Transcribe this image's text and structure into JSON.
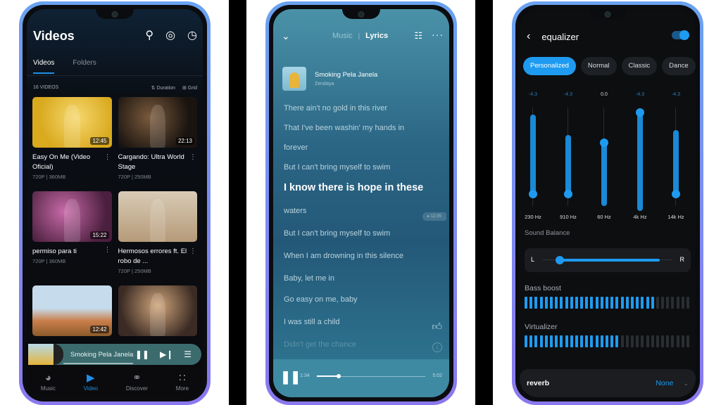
{
  "phone1": {
    "title": "Videos",
    "header_icons": [
      "search-icon",
      "radar-icon",
      "history-icon"
    ],
    "tabs": [
      {
        "label": "Videos",
        "active": true
      },
      {
        "label": "Folders",
        "active": false
      }
    ],
    "count_label": "16 VIDEOS",
    "sort_label": "Duration",
    "view_label": "Grid",
    "videos": [
      {
        "title": "Easy On Me (Video Oficial)",
        "meta": "720P | 360MB",
        "duration": "12:45"
      },
      {
        "title": "Cargando: Ultra World Stage",
        "meta": "720P | 250MB",
        "duration": "22:13"
      },
      {
        "title": "permiso para ti",
        "meta": "720P | 360MB",
        "duration": "15:22"
      },
      {
        "title": "Hermosos errores ft. El robo de ...",
        "meta": "720P | 250MB",
        "duration": ""
      },
      {
        "title": "",
        "meta": "",
        "duration": "12:42"
      },
      {
        "title": "",
        "meta": "",
        "duration": ""
      }
    ],
    "mini_player": {
      "title": "Smoking Pela Janela",
      "progress": 0.45
    },
    "nav": [
      {
        "label": "Music",
        "icon": "music-disc-icon",
        "active": false
      },
      {
        "label": "Video",
        "icon": "video-play-icon",
        "active": true
      },
      {
        "label": "Discover",
        "icon": "planet-icon",
        "active": false
      },
      {
        "label": "More",
        "icon": "grid-more-icon",
        "active": false
      }
    ]
  },
  "phone2": {
    "tabs": {
      "music": "Music",
      "separator": "|",
      "lyrics": "Lyrics"
    },
    "song": {
      "title": "Smoking Pela Janela",
      "artist": "Zendaya"
    },
    "lyrics": [
      {
        "text": "There ain't no gold in this river",
        "state": "normal"
      },
      {
        "text": "That I've been washin' my hands in",
        "state": "normal"
      },
      {
        "text": "forever",
        "state": "normal"
      },
      {
        "text": "But I can't bring myself to swim",
        "state": "normal"
      },
      {
        "text": "I know there is hope in these",
        "state": "active"
      },
      {
        "text": "waters",
        "state": "normal"
      },
      {
        "text": "But I can't bring myself to swim",
        "state": "normal"
      },
      {
        "text": "When I am drowning in this silence",
        "state": "normal"
      },
      {
        "text": "Baby, let me in",
        "state": "normal"
      },
      {
        "text": "Go easy on me, baby",
        "state": "normal"
      },
      {
        "text": "I was still a child",
        "state": "normal"
      },
      {
        "text": "Didn't get the chance",
        "state": "fade"
      }
    ],
    "timestamp_badge": "12:35",
    "player": {
      "current": "1:34",
      "total": "5:02",
      "progress": 0.2
    }
  },
  "phone3": {
    "title": "equalizer",
    "enabled": true,
    "presets": [
      {
        "label": "Personalized",
        "active": true
      },
      {
        "label": "Normal",
        "active": false
      },
      {
        "label": "Classic",
        "active": false
      },
      {
        "label": "Dance",
        "active": false
      }
    ],
    "bands": [
      {
        "freq": "230 Hz",
        "value": "-4.3",
        "low": 0.12,
        "high": 0.93
      },
      {
        "freq": "910 Hz",
        "value": "-4.3",
        "low": 0.12,
        "high": 0.72
      },
      {
        "freq": "60 Hz",
        "value": "0.0",
        "low": 0.0,
        "high": 0.64
      },
      {
        "freq": "4k Hz",
        "value": "-4.3",
        "low": -0.05,
        "high": 0.95
      },
      {
        "freq": "14k Hz",
        "value": "-4.3",
        "low": 0.12,
        "high": 0.77
      }
    ],
    "sound_balance": {
      "label": "Sound Balance",
      "left": "L",
      "right": "R",
      "start": 0.13,
      "end": 0.9
    },
    "bass_boost": {
      "label": "Bass boost",
      "level": 26,
      "segments": 33
    },
    "virtualizer": {
      "label": "Virtualizer",
      "level": 19,
      "segments": 33
    },
    "reverb": {
      "label": "reverb",
      "value": "None"
    }
  }
}
